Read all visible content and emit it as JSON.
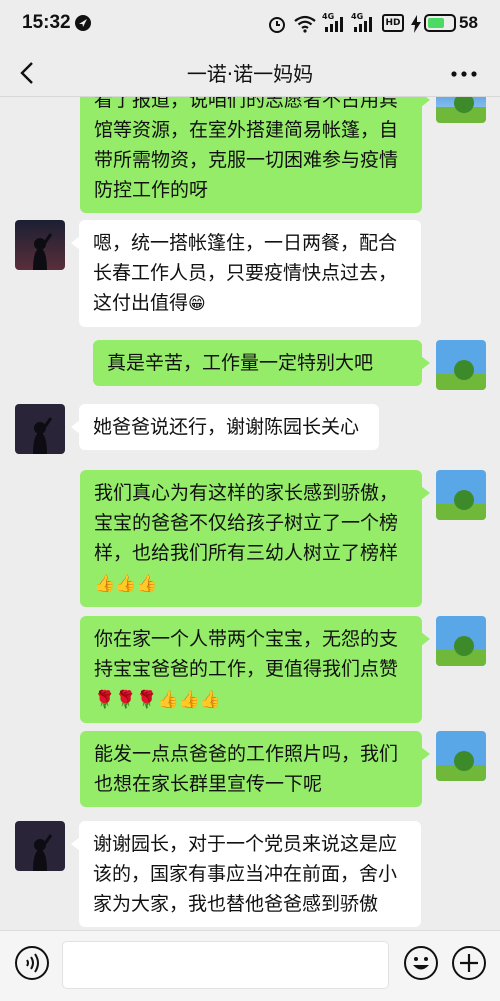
{
  "status": {
    "time": "15:32",
    "battery": "58",
    "network": "4G",
    "hd": "HD"
  },
  "header": {
    "title": "一诺·诺一妈妈"
  },
  "messages": [
    {
      "side": "right",
      "text": "看了报道，说咱们的志愿者不占用宾馆等资源，在室外搭建简易帐篷，自带所需物资，克服一切困难参与疫情防控工作的呀"
    },
    {
      "side": "left",
      "text": "嗯，统一搭帐篷住，一日两餐，配合长春工作人员，只要疫情快点过去，这付出值得",
      "emoji": "😁"
    },
    {
      "side": "right",
      "text": "真是辛苦，工作量一定特别大吧"
    },
    {
      "side": "left",
      "text": "她爸爸说还行，谢谢陈园长关心"
    },
    {
      "side": "right",
      "text": "我们真心为有这样的家长感到骄傲，宝宝的爸爸不仅给孩子树立了一个榜样，也给我们所有三幼人树立了榜样",
      "emoji": "👍👍👍"
    },
    {
      "side": "right",
      "text": "你在家一个人带两个宝宝，无怨的支持宝宝爸爸的工作，更值得我们点赞",
      "emoji": "🌹🌹🌹👍👍👍"
    },
    {
      "side": "right",
      "text": "能发一点点爸爸的工作照片吗，我们也想在家长群里宣传一下呢"
    },
    {
      "side": "left",
      "text": "谢谢园长，对于一个党员来说这是应该的，国家有事应当冲在前面，舍小家为大家，我也替他爸爸感到骄傲"
    }
  ],
  "icons": {
    "back": "chevron-left-icon",
    "more": "more-dots-icon",
    "voice": "voice-icon",
    "emoji": "emoji-icon",
    "plus": "plus-icon"
  },
  "colors": {
    "sent_bubble": "#95ec69",
    "received_bubble": "#ffffff",
    "background": "#ededed"
  }
}
